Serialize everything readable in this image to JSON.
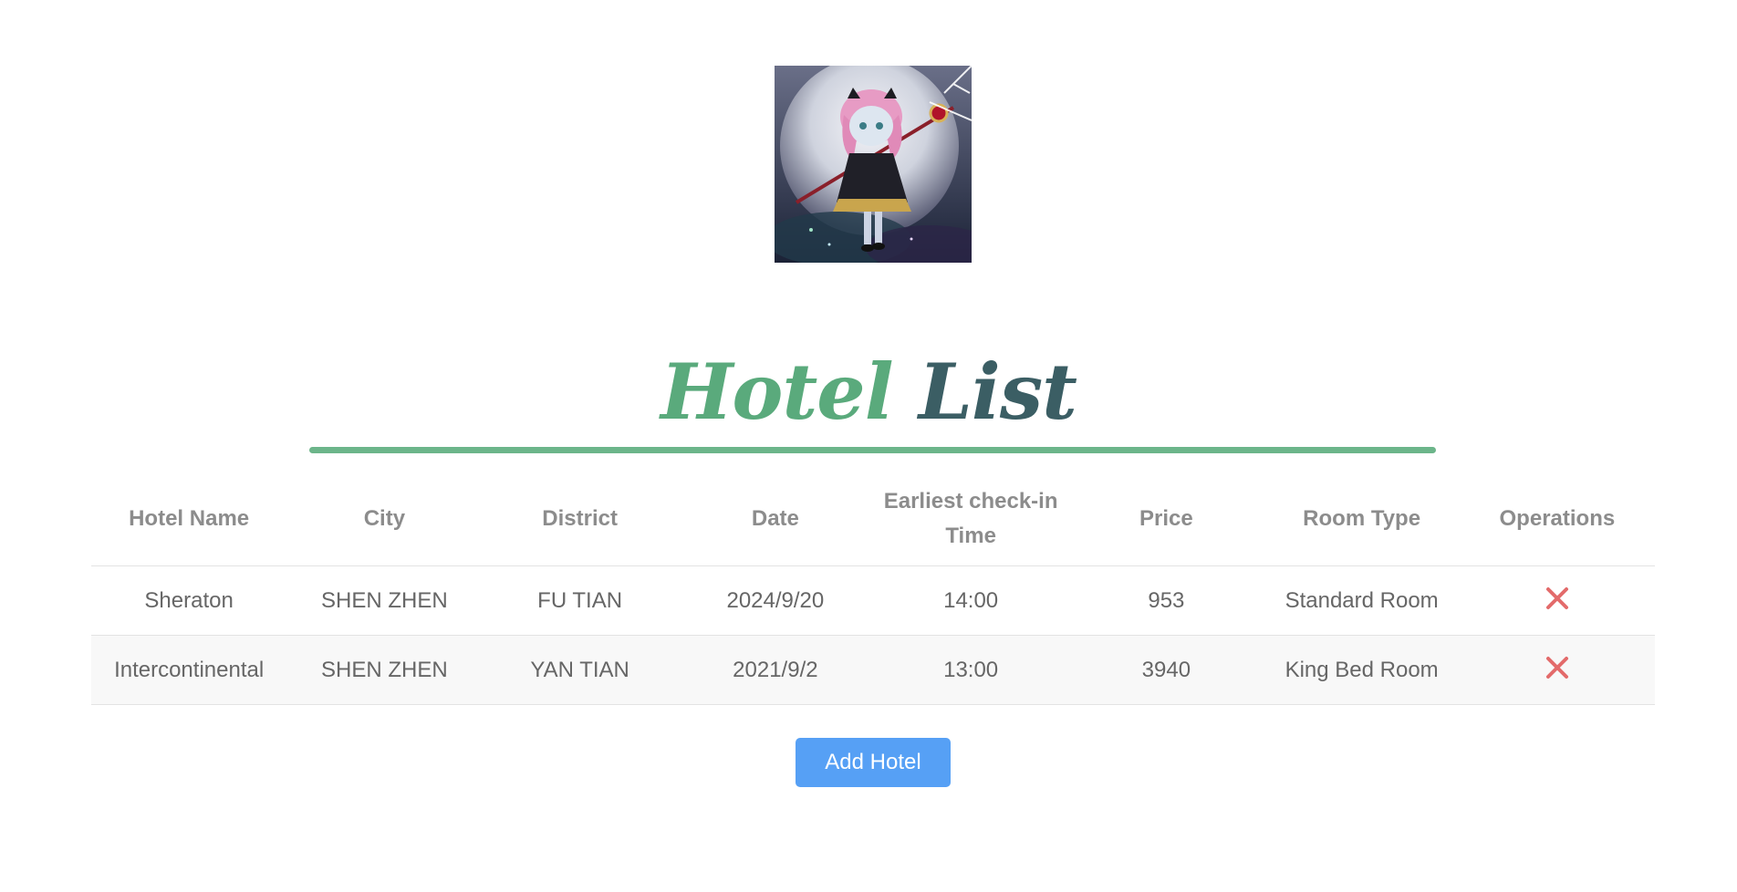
{
  "header": {
    "avatar_icon": "anime-girl-avatar-image",
    "title_word_1": "Hotel",
    "title_word_2": "List"
  },
  "colors": {
    "title_green": "#5aaa7c",
    "title_dark": "#3b5e64",
    "rule": "#6cb58a",
    "button": "#56a0f5",
    "delete": "#e36b6b"
  },
  "table": {
    "columns": [
      "Hotel Name",
      "City",
      "District",
      "Date",
      "Earliest check-in Time",
      "Price",
      "Room Type",
      "Operations"
    ],
    "rows": [
      {
        "hotel_name": "Sheraton",
        "city": "SHEN ZHEN",
        "district": "FU TIAN",
        "date": "2024/9/20",
        "checkin": "14:00",
        "price": "953",
        "room_type": "Standard Room",
        "operation_icon": "close-icon"
      },
      {
        "hotel_name": "Intercontinental",
        "city": "SHEN ZHEN",
        "district": "YAN TIAN",
        "date": "2021/9/2",
        "checkin": "13:00",
        "price": "3940",
        "room_type": "King Bed Room",
        "operation_icon": "close-icon"
      }
    ]
  },
  "actions": {
    "add_label": "Add Hotel"
  }
}
